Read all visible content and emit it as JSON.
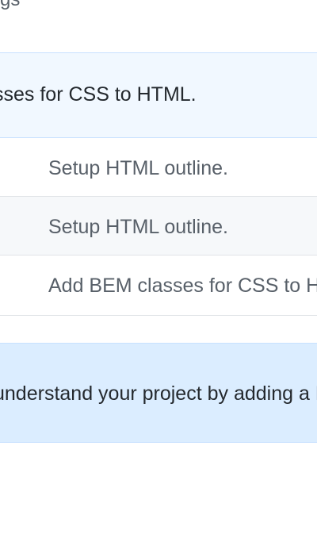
{
  "header": {
    "fragment_text": "gs"
  },
  "latest_commit": {
    "message": "sses for CSS to HTML."
  },
  "files": [
    {
      "commit_message": "Setup HTML outline."
    },
    {
      "commit_message": "Setup HTML outline."
    },
    {
      "commit_message": "Add BEM classes for CSS to HTML."
    }
  ],
  "readme_prompt": {
    "text": "understand your project by adding a README."
  },
  "colors": {
    "commit_banner_bg": "#f1f8ff",
    "readme_banner_bg": "#dbedff",
    "border": "#e1e4e8",
    "muted_text": "#586069"
  }
}
